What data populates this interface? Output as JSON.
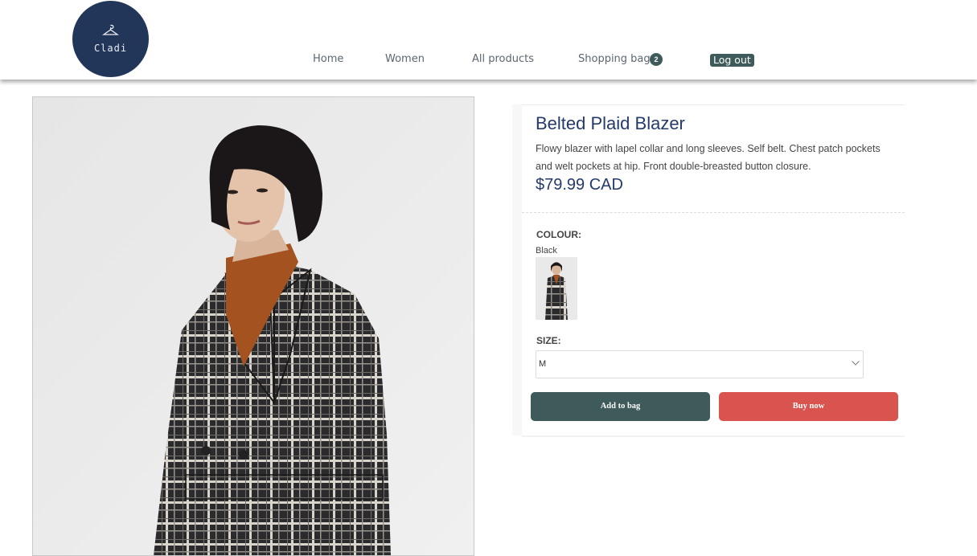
{
  "brand": {
    "name": "Cladi",
    "icon": "hanger-icon",
    "background_color": "#223659"
  },
  "nav": {
    "home": "Home",
    "women": "Women",
    "all_products": "All products",
    "shopping_bag": "Shopping bag",
    "bag_count": "2",
    "logout": "Log out"
  },
  "product": {
    "title": "Belted Plaid Blazer",
    "description": "Flowy blazer with lapel collar and long sleeves. Self belt. Chest patch pockets and welt pockets at hip. Front double-breasted button closure.",
    "price": "$79.99 CAD",
    "colour_label": "COLOUR:",
    "colour_value": "Black",
    "size_label": "SIZE:",
    "size_value": "M",
    "add_to_bag": "Add to bag",
    "buy_now": "Buy now"
  },
  "colors": {
    "accent": "#3e5a5a",
    "buy": "#d9534f",
    "title": "#243a6b"
  }
}
